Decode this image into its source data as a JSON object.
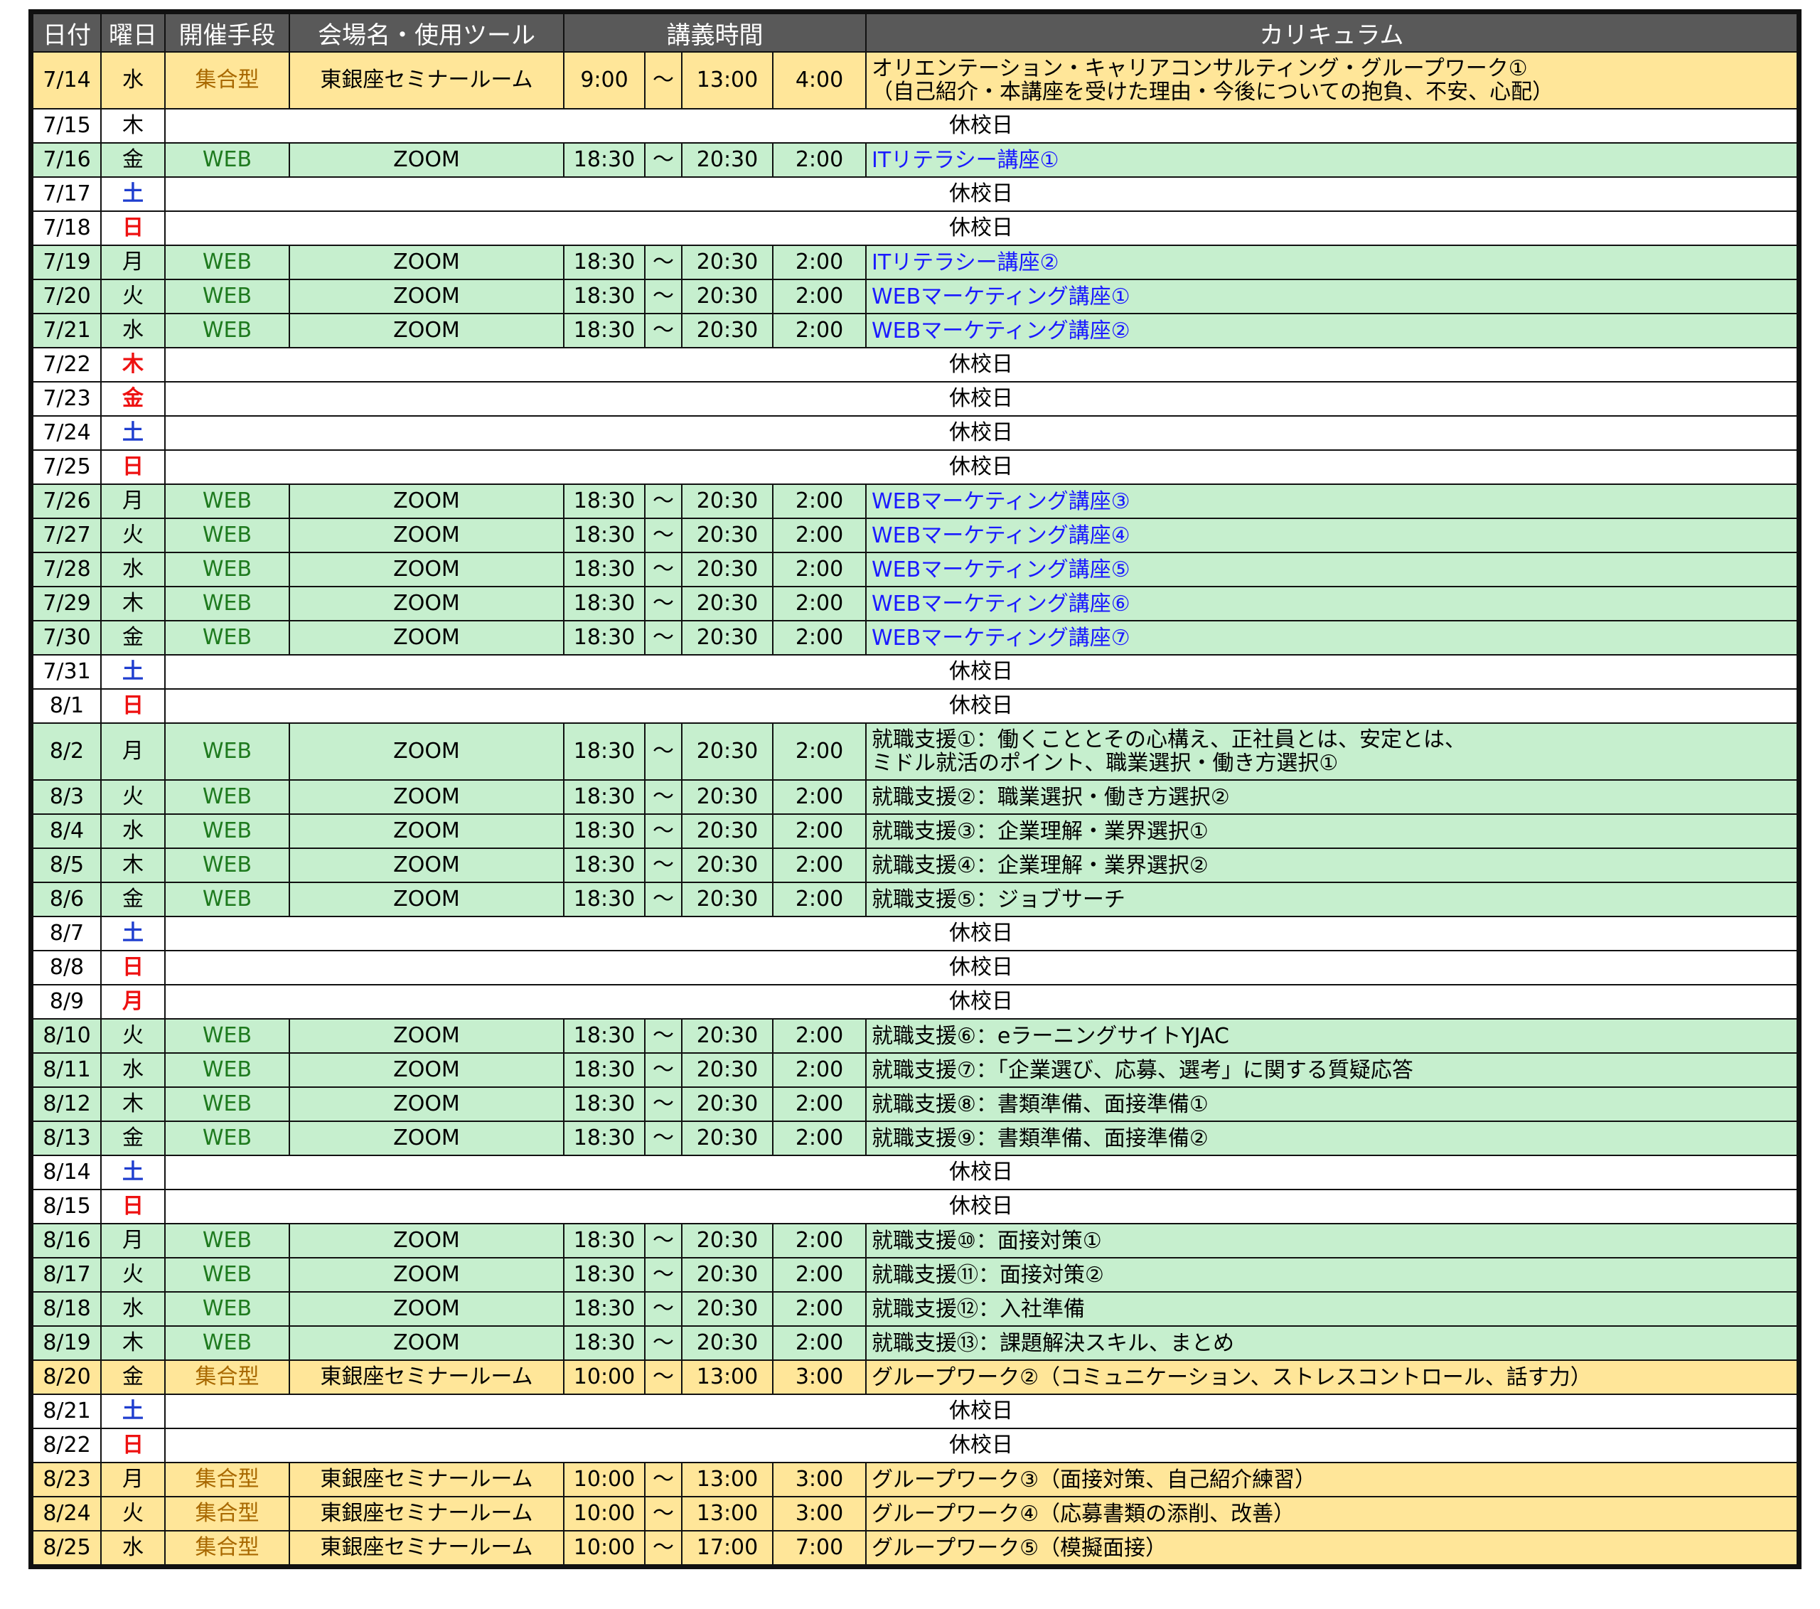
{
  "headers": {
    "date": "日付",
    "day": "曜日",
    "mode": "開催手段",
    "venue": "会場名・使用ツール",
    "time": "講義時間",
    "curriculum": "カリキュラム"
  },
  "rows": [
    {
      "date": "7/14",
      "day": "水",
      "dayColor": "normal",
      "kind": "grp",
      "mode": "集合型",
      "venue": "東銀座セミナールーム",
      "start": "9:00",
      "sep": "～",
      "end": "13:00",
      "dur": "4:00",
      "blue": false,
      "cur": [
        "オリエンテーション・キャリアコンサルティング・グループワーク①",
        "（自己紹介・本講座を受けた理由・今後についての抱負、不安、心配）"
      ]
    },
    {
      "date": "7/15",
      "day": "木",
      "dayColor": "normal",
      "kind": "off",
      "offText": "休校日"
    },
    {
      "date": "7/16",
      "day": "金",
      "dayColor": "normal",
      "kind": "web",
      "mode": "WEB",
      "venue": "ZOOM",
      "start": "18:30",
      "sep": "～",
      "end": "20:30",
      "dur": "2:00",
      "blue": true,
      "cur": [
        "ITリテラシー講座①"
      ]
    },
    {
      "date": "7/17",
      "day": "土",
      "dayColor": "sat",
      "kind": "off",
      "offText": "休校日"
    },
    {
      "date": "7/18",
      "day": "日",
      "dayColor": "red",
      "kind": "off",
      "offText": "休校日"
    },
    {
      "date": "7/19",
      "day": "月",
      "dayColor": "normal",
      "kind": "web",
      "mode": "WEB",
      "venue": "ZOOM",
      "start": "18:30",
      "sep": "～",
      "end": "20:30",
      "dur": "2:00",
      "blue": true,
      "cur": [
        "ITリテラシー講座②"
      ]
    },
    {
      "date": "7/20",
      "day": "火",
      "dayColor": "normal",
      "kind": "web",
      "mode": "WEB",
      "venue": "ZOOM",
      "start": "18:30",
      "sep": "～",
      "end": "20:30",
      "dur": "2:00",
      "blue": true,
      "cur": [
        "WEBマーケティング講座①"
      ]
    },
    {
      "date": "7/21",
      "day": "水",
      "dayColor": "normal",
      "kind": "web",
      "mode": "WEB",
      "venue": "ZOOM",
      "start": "18:30",
      "sep": "～",
      "end": "20:30",
      "dur": "2:00",
      "blue": true,
      "cur": [
        "WEBマーケティング講座②"
      ]
    },
    {
      "date": "7/22",
      "day": "木",
      "dayColor": "red",
      "kind": "off",
      "offText": "休校日"
    },
    {
      "date": "7/23",
      "day": "金",
      "dayColor": "red",
      "kind": "off",
      "offText": "休校日"
    },
    {
      "date": "7/24",
      "day": "土",
      "dayColor": "sat",
      "kind": "off",
      "offText": "休校日"
    },
    {
      "date": "7/25",
      "day": "日",
      "dayColor": "red",
      "kind": "off",
      "offText": "休校日"
    },
    {
      "date": "7/26",
      "day": "月",
      "dayColor": "normal",
      "kind": "web",
      "mode": "WEB",
      "venue": "ZOOM",
      "start": "18:30",
      "sep": "～",
      "end": "20:30",
      "dur": "2:00",
      "blue": true,
      "cur": [
        "WEBマーケティング講座③"
      ]
    },
    {
      "date": "7/27",
      "day": "火",
      "dayColor": "normal",
      "kind": "web",
      "mode": "WEB",
      "venue": "ZOOM",
      "start": "18:30",
      "sep": "～",
      "end": "20:30",
      "dur": "2:00",
      "blue": true,
      "cur": [
        "WEBマーケティング講座④"
      ]
    },
    {
      "date": "7/28",
      "day": "水",
      "dayColor": "normal",
      "kind": "web",
      "mode": "WEB",
      "venue": "ZOOM",
      "start": "18:30",
      "sep": "～",
      "end": "20:30",
      "dur": "2:00",
      "blue": true,
      "cur": [
        "WEBマーケティング講座⑤"
      ]
    },
    {
      "date": "7/29",
      "day": "木",
      "dayColor": "normal",
      "kind": "web",
      "mode": "WEB",
      "venue": "ZOOM",
      "start": "18:30",
      "sep": "～",
      "end": "20:30",
      "dur": "2:00",
      "blue": true,
      "cur": [
        "WEBマーケティング講座⑥"
      ]
    },
    {
      "date": "7/30",
      "day": "金",
      "dayColor": "normal",
      "kind": "web",
      "mode": "WEB",
      "venue": "ZOOM",
      "start": "18:30",
      "sep": "～",
      "end": "20:30",
      "dur": "2:00",
      "blue": true,
      "cur": [
        "WEBマーケティング講座⑦"
      ]
    },
    {
      "date": "7/31",
      "day": "土",
      "dayColor": "sat",
      "kind": "off",
      "offText": "休校日"
    },
    {
      "date": "8/1",
      "day": "日",
      "dayColor": "red",
      "kind": "off",
      "offText": "休校日"
    },
    {
      "date": "8/2",
      "day": "月",
      "dayColor": "normal",
      "kind": "web",
      "mode": "WEB",
      "venue": "ZOOM",
      "start": "18:30",
      "sep": "～",
      "end": "20:30",
      "dur": "2:00",
      "blue": false,
      "cur": [
        "就職支援①：働くこととその心構え、正社員とは、安定とは、",
        "ミドル就活のポイント、職業選択・働き方選択①"
      ]
    },
    {
      "date": "8/3",
      "day": "火",
      "dayColor": "normal",
      "kind": "web",
      "mode": "WEB",
      "venue": "ZOOM",
      "start": "18:30",
      "sep": "～",
      "end": "20:30",
      "dur": "2:00",
      "blue": false,
      "cur": [
        "就職支援②：職業選択・働き方選択②"
      ]
    },
    {
      "date": "8/4",
      "day": "水",
      "dayColor": "normal",
      "kind": "web",
      "mode": "WEB",
      "venue": "ZOOM",
      "start": "18:30",
      "sep": "～",
      "end": "20:30",
      "dur": "2:00",
      "blue": false,
      "cur": [
        "就職支援③：企業理解・業界選択①"
      ]
    },
    {
      "date": "8/5",
      "day": "木",
      "dayColor": "normal",
      "kind": "web",
      "mode": "WEB",
      "venue": "ZOOM",
      "start": "18:30",
      "sep": "～",
      "end": "20:30",
      "dur": "2:00",
      "blue": false,
      "cur": [
        "就職支援④：企業理解・業界選択②"
      ]
    },
    {
      "date": "8/6",
      "day": "金",
      "dayColor": "normal",
      "kind": "web",
      "mode": "WEB",
      "venue": "ZOOM",
      "start": "18:30",
      "sep": "～",
      "end": "20:30",
      "dur": "2:00",
      "blue": false,
      "cur": [
        "就職支援⑤：ジョブサーチ"
      ]
    },
    {
      "date": "8/7",
      "day": "土",
      "dayColor": "sat",
      "kind": "off",
      "offText": "休校日"
    },
    {
      "date": "8/8",
      "day": "日",
      "dayColor": "red",
      "kind": "off",
      "offText": "休校日"
    },
    {
      "date": "8/9",
      "day": "月",
      "dayColor": "red",
      "kind": "off",
      "offText": "休校日"
    },
    {
      "date": "8/10",
      "day": "火",
      "dayColor": "normal",
      "kind": "web",
      "mode": "WEB",
      "venue": "ZOOM",
      "start": "18:30",
      "sep": "～",
      "end": "20:30",
      "dur": "2:00",
      "blue": false,
      "cur": [
        "就職支援⑥：eラーニングサイトYJAC"
      ]
    },
    {
      "date": "8/11",
      "day": "水",
      "dayColor": "normal",
      "kind": "web",
      "mode": "WEB",
      "venue": "ZOOM",
      "start": "18:30",
      "sep": "～",
      "end": "20:30",
      "dur": "2:00",
      "blue": false,
      "cur": [
        "就職支援⑦：「企業選び、応募、選考」に関する質疑応答"
      ]
    },
    {
      "date": "8/12",
      "day": "木",
      "dayColor": "normal",
      "kind": "web",
      "mode": "WEB",
      "venue": "ZOOM",
      "start": "18:30",
      "sep": "～",
      "end": "20:30",
      "dur": "2:00",
      "blue": false,
      "cur": [
        "就職支援⑧：書類準備、面接準備①"
      ]
    },
    {
      "date": "8/13",
      "day": "金",
      "dayColor": "normal",
      "kind": "web",
      "mode": "WEB",
      "venue": "ZOOM",
      "start": "18:30",
      "sep": "～",
      "end": "20:30",
      "dur": "2:00",
      "blue": false,
      "cur": [
        "就職支援⑨：書類準備、面接準備②"
      ]
    },
    {
      "date": "8/14",
      "day": "土",
      "dayColor": "sat",
      "kind": "off",
      "offText": "休校日"
    },
    {
      "date": "8/15",
      "day": "日",
      "dayColor": "red",
      "kind": "off",
      "offText": "休校日"
    },
    {
      "date": "8/16",
      "day": "月",
      "dayColor": "normal",
      "kind": "web",
      "mode": "WEB",
      "venue": "ZOOM",
      "start": "18:30",
      "sep": "～",
      "end": "20:30",
      "dur": "2:00",
      "blue": false,
      "cur": [
        "就職支援⑩：面接対策①"
      ]
    },
    {
      "date": "8/17",
      "day": "火",
      "dayColor": "normal",
      "kind": "web",
      "mode": "WEB",
      "venue": "ZOOM",
      "start": "18:30",
      "sep": "～",
      "end": "20:30",
      "dur": "2:00",
      "blue": false,
      "cur": [
        "就職支援⑪：面接対策②"
      ]
    },
    {
      "date": "8/18",
      "day": "水",
      "dayColor": "normal",
      "kind": "web",
      "mode": "WEB",
      "venue": "ZOOM",
      "start": "18:30",
      "sep": "～",
      "end": "20:30",
      "dur": "2:00",
      "blue": false,
      "cur": [
        "就職支援⑫：入社準備"
      ]
    },
    {
      "date": "8/19",
      "day": "木",
      "dayColor": "normal",
      "kind": "web",
      "mode": "WEB",
      "venue": "ZOOM",
      "start": "18:30",
      "sep": "～",
      "end": "20:30",
      "dur": "2:00",
      "blue": false,
      "cur": [
        "就職支援⑬：課題解決スキル、まとめ"
      ]
    },
    {
      "date": "8/20",
      "day": "金",
      "dayColor": "normal",
      "kind": "grp",
      "mode": "集合型",
      "venue": "東銀座セミナールーム",
      "start": "10:00",
      "sep": "～",
      "end": "13:00",
      "dur": "3:00",
      "blue": false,
      "cur": [
        "グループワーク②（コミュニケーション、ストレスコントロール、話す力）"
      ]
    },
    {
      "date": "8/21",
      "day": "土",
      "dayColor": "sat",
      "kind": "off",
      "offText": "休校日"
    },
    {
      "date": "8/22",
      "day": "日",
      "dayColor": "red",
      "kind": "off",
      "offText": "休校日"
    },
    {
      "date": "8/23",
      "day": "月",
      "dayColor": "normal",
      "kind": "grp",
      "mode": "集合型",
      "venue": "東銀座セミナールーム",
      "start": "10:00",
      "sep": "～",
      "end": "13:00",
      "dur": "3:00",
      "blue": false,
      "cur": [
        "グループワーク③（面接対策、自己紹介練習）"
      ]
    },
    {
      "date": "8/24",
      "day": "火",
      "dayColor": "normal",
      "kind": "grp",
      "mode": "集合型",
      "venue": "東銀座セミナールーム",
      "start": "10:00",
      "sep": "～",
      "end": "13:00",
      "dur": "3:00",
      "blue": false,
      "cur": [
        "グループワーク④（応募書類の添削、改善）"
      ]
    },
    {
      "date": "8/25",
      "day": "水",
      "dayColor": "normal",
      "kind": "grp",
      "mode": "集合型",
      "venue": "東銀座セミナールーム",
      "start": "10:00",
      "sep": "～",
      "end": "17:00",
      "dur": "7:00",
      "blue": false,
      "cur": [
        "グループワーク⑤（模擬面接）"
      ]
    }
  ]
}
